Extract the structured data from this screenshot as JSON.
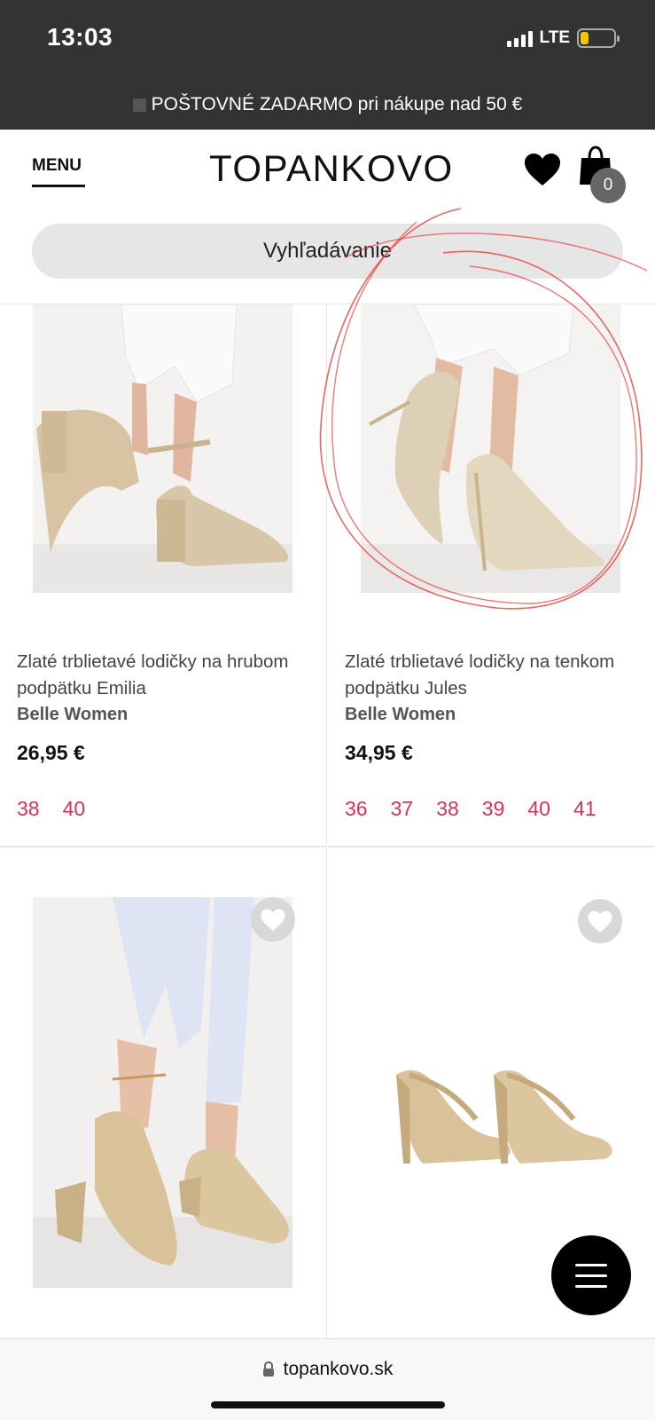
{
  "status_bar": {
    "time": "13:03",
    "network": "LTE",
    "battery_color": "#f5c400"
  },
  "promo": {
    "text": "POŠTOVNÉ ZADARMO pri nákupe nad 50 €"
  },
  "header": {
    "menu_label": "MENU",
    "logo": "TOPANKOVO",
    "cart_count": "0",
    "icons": [
      "heart-icon",
      "cart-icon"
    ]
  },
  "search": {
    "placeholder": "Vyhľadávanie"
  },
  "products": [
    {
      "name": "Zlaté trblietavé lodičky na hrubom podpätku Emilia",
      "brand": "Belle Women",
      "price": "26,95 €",
      "sizes": [
        "38",
        "40"
      ]
    },
    {
      "name": "Zlaté trblietavé lodičky na tenkom podpätku Jules",
      "brand": "Belle Women",
      "price": "34,95 €",
      "sizes": [
        "36",
        "37",
        "38",
        "39",
        "40",
        "41"
      ]
    },
    {
      "name": "",
      "brand": "",
      "price": "",
      "sizes": []
    },
    {
      "name": "",
      "brand": "",
      "price": "",
      "sizes": []
    }
  ],
  "url_bar": {
    "domain": "topankovo.sk"
  },
  "colors": {
    "dark_bar": "#333333",
    "size_accent": "#d6305b",
    "scribble": "#e8403c"
  }
}
